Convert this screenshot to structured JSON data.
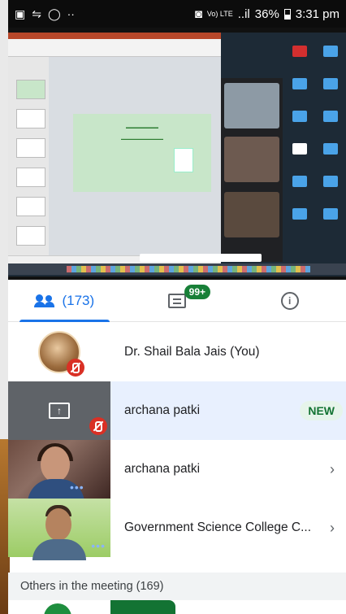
{
  "status_bar": {
    "left_icons": [
      "image-icon",
      "wifi-calling-icon",
      "whatsapp-icon",
      "more-notifications-icon"
    ],
    "more_dots": "··",
    "network": "Vo) LTE",
    "signal": "..il",
    "battery": "36%",
    "time": "3:31 pm"
  },
  "tabs": {
    "people_count": "(173)",
    "chat_badge": "99+",
    "info_label": "i"
  },
  "participants": [
    {
      "name": "Dr. Shail Bala Jais (You)",
      "muted": true
    },
    {
      "name": "archana patki",
      "badge": "NEW",
      "presenting": true,
      "muted": true
    },
    {
      "name": "archana patki",
      "chevron": "›"
    },
    {
      "name": "Government Science College C...",
      "chevron": "›"
    }
  ],
  "section_header": "Others in the meeting (169)",
  "colors": {
    "accent": "#1a73e8",
    "badge_green": "#188038",
    "mute_red": "#d93025",
    "new_badge_bg": "#e6f4ea"
  }
}
